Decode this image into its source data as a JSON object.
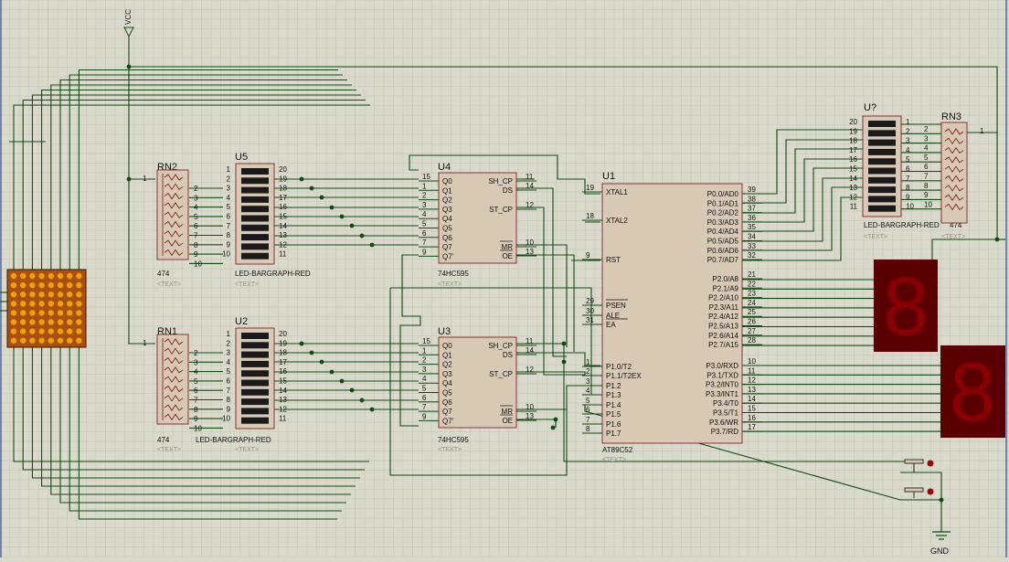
{
  "power": {
    "vcc": "VCC",
    "gnd": "GND"
  },
  "placeholder": "<TEXT>",
  "parts": {
    "u4": {
      "ref": "U4",
      "model": "74HC595",
      "left_pins": [
        [
          "15",
          "Q0"
        ],
        [
          "1",
          "Q1"
        ],
        [
          "2",
          "Q2"
        ],
        [
          "3",
          "Q3"
        ],
        [
          "4",
          "Q4"
        ],
        [
          "5",
          "Q5"
        ],
        [
          "6",
          "Q6"
        ],
        [
          "7",
          "Q7"
        ],
        [
          "9",
          "Q7'"
        ]
      ],
      "right_pins": [
        [
          "11",
          "SH_CP"
        ],
        [
          "14",
          "DS"
        ],
        [
          "12",
          "ST_CP"
        ],
        [
          "10",
          "MR"
        ],
        [
          "13",
          "OE"
        ]
      ]
    },
    "u3": {
      "ref": "U3",
      "model": "74HC595",
      "left_pins": [
        [
          "15",
          "Q0"
        ],
        [
          "1",
          "Q1"
        ],
        [
          "2",
          "Q2"
        ],
        [
          "3",
          "Q3"
        ],
        [
          "4",
          "Q4"
        ],
        [
          "5",
          "Q5"
        ],
        [
          "6",
          "Q6"
        ],
        [
          "7",
          "Q7"
        ],
        [
          "9",
          "Q7'"
        ]
      ],
      "right_pins": [
        [
          "11",
          "SH_CP"
        ],
        [
          "14",
          "DS"
        ],
        [
          "12",
          "ST_CP"
        ],
        [
          "10",
          "MR"
        ],
        [
          "13",
          "OE"
        ]
      ]
    },
    "u1": {
      "ref": "U1",
      "model": "AT89C52",
      "left_pins": [
        [
          "19",
          "XTAL1"
        ],
        [
          "18",
          "XTAL2"
        ],
        [
          "9",
          "RST"
        ],
        [
          "29",
          "PSEN"
        ],
        [
          "30",
          "ALE"
        ],
        [
          "31",
          "EA"
        ],
        [
          "1",
          "P1.0/T2"
        ],
        [
          "2",
          "P1.1/T2EX"
        ],
        [
          "3",
          "P1.2"
        ],
        [
          "4",
          "P1.3"
        ],
        [
          "5",
          "P1.4"
        ],
        [
          "6",
          "P1.5"
        ],
        [
          "7",
          "P1.6"
        ],
        [
          "8",
          "P1.7"
        ]
      ],
      "right_pins": [
        [
          "39",
          "P0.0/AD0"
        ],
        [
          "38",
          "P0.1/AD1"
        ],
        [
          "37",
          "P0.2/AD2"
        ],
        [
          "36",
          "P0.3/AD3"
        ],
        [
          "35",
          "P0.4/AD4"
        ],
        [
          "34",
          "P0.5/AD5"
        ],
        [
          "33",
          "P0.6/AD6"
        ],
        [
          "32",
          "P0.7/AD7"
        ],
        [
          "21",
          "P2.0/A8"
        ],
        [
          "22",
          "P2.1/A9"
        ],
        [
          "23",
          "P2.2/A10"
        ],
        [
          "24",
          "P2.3/A11"
        ],
        [
          "25",
          "P2.4/A12"
        ],
        [
          "26",
          "P2.5/A13"
        ],
        [
          "27",
          "P2.6/A14"
        ],
        [
          "28",
          "P2.7/A15"
        ],
        [
          "10",
          "P3.0/RXD"
        ],
        [
          "11",
          "P3.1/TXD"
        ],
        [
          "12",
          "P3.2/INT0"
        ],
        [
          "13",
          "P3.3/INT1"
        ],
        [
          "14",
          "P3.4/T0"
        ],
        [
          "15",
          "P3.5/T1"
        ],
        [
          "16",
          "P3.6/WR"
        ],
        [
          "17",
          "P3.7/RD"
        ]
      ]
    },
    "u5": {
      "ref": "U5",
      "model": "LED-BARGRAPH-RED",
      "left_nums": [
        "1",
        "2",
        "3",
        "4",
        "5",
        "6",
        "7",
        "8",
        "9",
        "10"
      ],
      "right_nums": [
        "20",
        "19",
        "18",
        "17",
        "16",
        "15",
        "14",
        "13",
        "12",
        "11"
      ]
    },
    "u2": {
      "ref": "U2",
      "model": "LED-BARGRAPH-RED",
      "left_nums": [
        "1",
        "2",
        "3",
        "4",
        "5",
        "6",
        "7",
        "8",
        "9",
        "10"
      ],
      "right_nums": [
        "20",
        "19",
        "18",
        "17",
        "16",
        "15",
        "14",
        "13",
        "12",
        "11"
      ]
    },
    "u7": {
      "ref": "U?",
      "model": "LED-BARGRAPH-RED",
      "left_nums": [
        "20",
        "19",
        "18",
        "17",
        "16",
        "15",
        "14",
        "13",
        "12",
        "11"
      ],
      "right_nums": [
        "1",
        "2",
        "3",
        "4",
        "5",
        "6",
        "7",
        "8",
        "9",
        "10"
      ]
    },
    "rn2": {
      "ref": "RN2",
      "model": "474",
      "common_pin": "1",
      "pins": [
        "2",
        "3",
        "4",
        "5",
        "6",
        "7",
        "8",
        "9",
        "10"
      ]
    },
    "rn1": {
      "ref": "RN1",
      "model": "474",
      "common_pin": "1",
      "pins": [
        "2",
        "3",
        "4",
        "5",
        "6",
        "7",
        "8",
        "9",
        "10"
      ]
    },
    "rn3": {
      "ref": "RN3",
      "model": "474",
      "common_pin": "1",
      "pins": [
        "2",
        "3",
        "4",
        "5",
        "6",
        "7",
        "8",
        "9",
        "10"
      ]
    }
  },
  "seven_segment_digit": "8",
  "colors": {
    "background": "#d9d9cc",
    "grid": "#c6c6b6",
    "wire": "#0f4d0f",
    "body": "#d8c9b4",
    "body_stroke": "#7a1010",
    "pin_label": "#101010",
    "pin_num": "#101010",
    "led": "#1a1a1a",
    "matrix_bg": "#a85010",
    "matrix_dot": "#f0a000",
    "seg_bg": "#5a0000",
    "seg_on": "#8a0000"
  }
}
